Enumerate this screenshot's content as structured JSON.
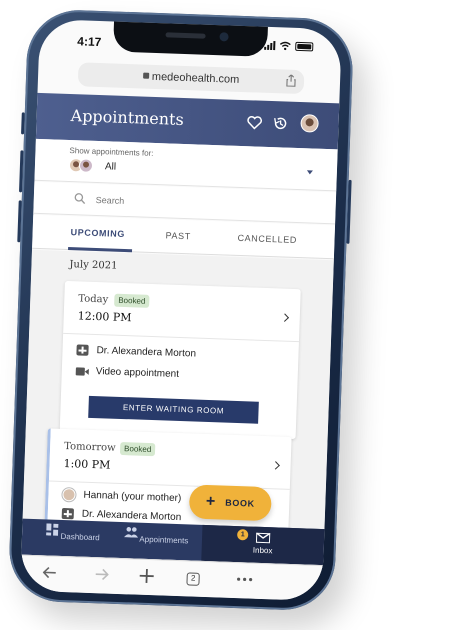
{
  "status_bar": {
    "time": "4:17"
  },
  "browser": {
    "url": "medeohealth.com",
    "tab_count": "2"
  },
  "header": {
    "title": "Appointments"
  },
  "filter": {
    "label": "Show appointments for:",
    "value": "All"
  },
  "search": {
    "placeholder": "Search"
  },
  "tabs": [
    {
      "label": "UPCOMING",
      "active": true
    },
    {
      "label": "PAST",
      "active": false
    },
    {
      "label": "CANCELLED",
      "active": false
    }
  ],
  "month": "July 2021",
  "appointments": [
    {
      "day": "Today",
      "status": "Booked",
      "time": "12:00 PM",
      "doctor": "Dr. Alexandera Morton",
      "type": "Video appointment",
      "action": "ENTER WAITING ROOM"
    },
    {
      "day": "Tomorrow",
      "status": "Booked",
      "time": "1:00 PM",
      "patient": "Hannah (your mother)",
      "doctor": "Dr. Alexandera Morton"
    }
  ],
  "fab": {
    "icon": "plus-icon",
    "label": "BOOK"
  },
  "bottom_nav": [
    {
      "label": "Dashboard",
      "icon": "dashboard-icon"
    },
    {
      "label": "Appointments",
      "icon": "people-icon"
    },
    {
      "label": "Inbox",
      "icon": "mail-icon",
      "badge": "1",
      "active": true
    }
  ],
  "colors": {
    "header": "#3d4c78",
    "accent": "#f0b23a",
    "booked_badge": "#d6e9d0",
    "nav": "#2b3a63"
  }
}
